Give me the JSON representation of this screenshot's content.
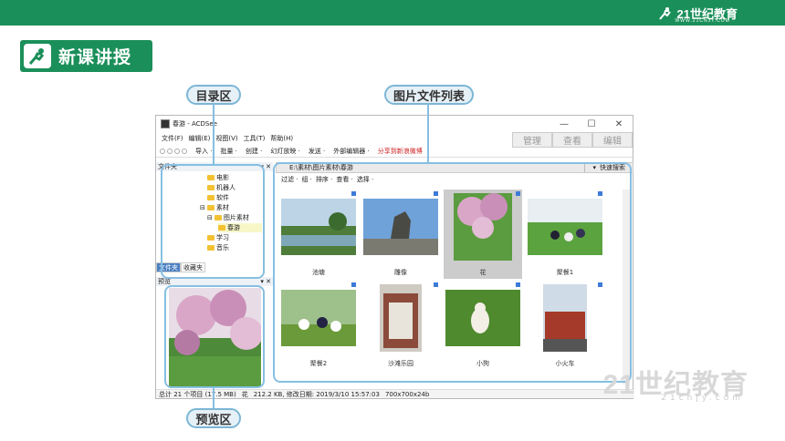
{
  "brand": {
    "logo_text": "21世纪教育",
    "logo_sub": "WWW.21CNJY.COM"
  },
  "lesson": {
    "title": "新课讲授"
  },
  "labels": {
    "dir": "目录区",
    "files": "图片文件列表",
    "preview": "预览区"
  },
  "window": {
    "title": "春游 - ACDSee",
    "controls": [
      "—",
      "☐",
      "✕"
    ],
    "menu": [
      "文件(F)",
      "编辑(E)",
      "视图(V)",
      "工具(T)",
      "帮助(H)"
    ],
    "modes": [
      "管理",
      "查看",
      "编辑"
    ],
    "toolbar": [
      "导入 ·",
      "批量 ·",
      "创建 ·",
      "幻灯放映 ·",
      "发送 ·",
      "外部编辑器 ·",
      "分享到新浪微博"
    ],
    "left_title": "文件夹",
    "tree": [
      "电影",
      "机器人",
      "软件",
      "素材",
      "图片素材",
      "春游",
      "学习",
      "音乐"
    ],
    "tabs": [
      "文件夹",
      "收藏夹"
    ],
    "preview_title": "预览",
    "path": "E:\\素材\\图片素材\\春游",
    "quick_search": "快速搜索",
    "filter": [
      "过滤 ·",
      "组 ·",
      "排序 ·",
      "查看 ·",
      "选择 ·"
    ],
    "items": [
      "池塘",
      "雕像",
      "花",
      "聚餐1",
      "聚餐2",
      "沙滩乐园",
      "小狗",
      "小火车"
    ],
    "status": {
      "total": "总计 21 个项目 (17.5 MB)",
      "name": "花",
      "info": "212.2 KB, 修改日期: 2019/3/10 15:57:03",
      "dims": "700x700x24b"
    }
  },
  "watermark": {
    "main": "21世纪教育",
    "sub": "21cnjy.com"
  }
}
